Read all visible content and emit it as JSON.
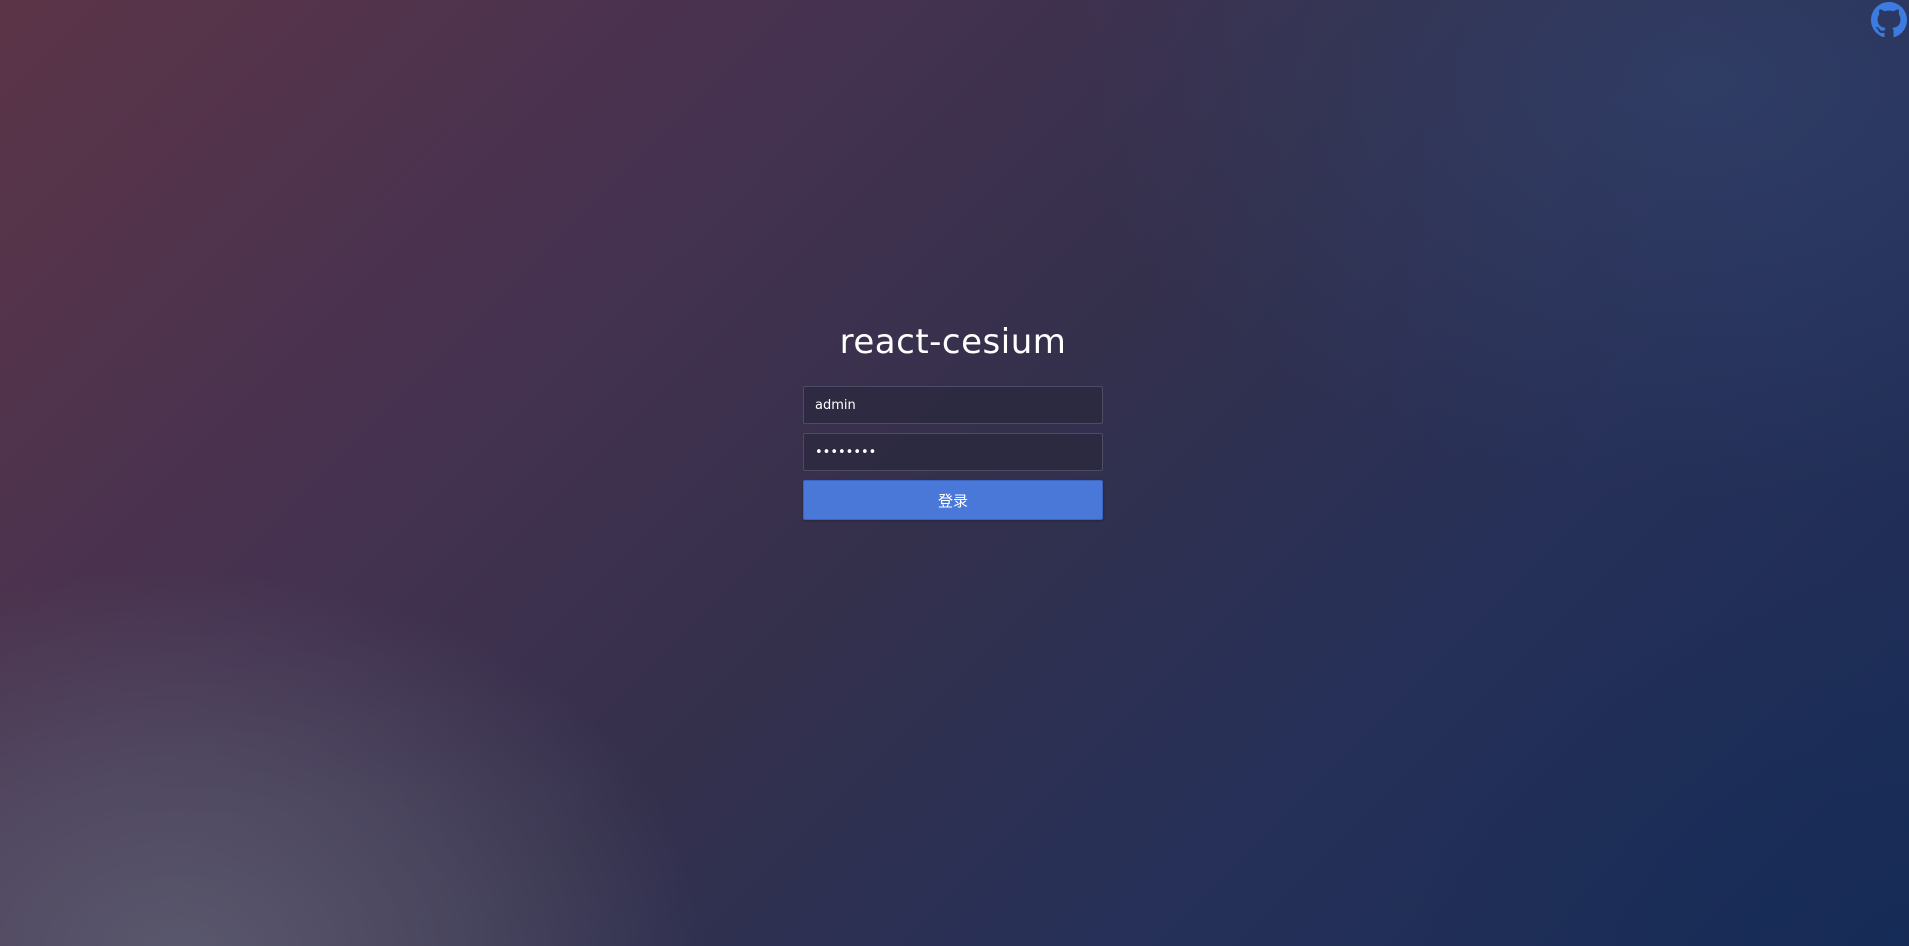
{
  "app": {
    "title": "react-cesium"
  },
  "header": {
    "github_icon": "github-icon",
    "icon_color": "#3c7be0"
  },
  "login_form": {
    "username": {
      "value": "admin"
    },
    "password": {
      "value": "********"
    },
    "submit_label": "登录",
    "button_color": "#4a78d9"
  }
}
